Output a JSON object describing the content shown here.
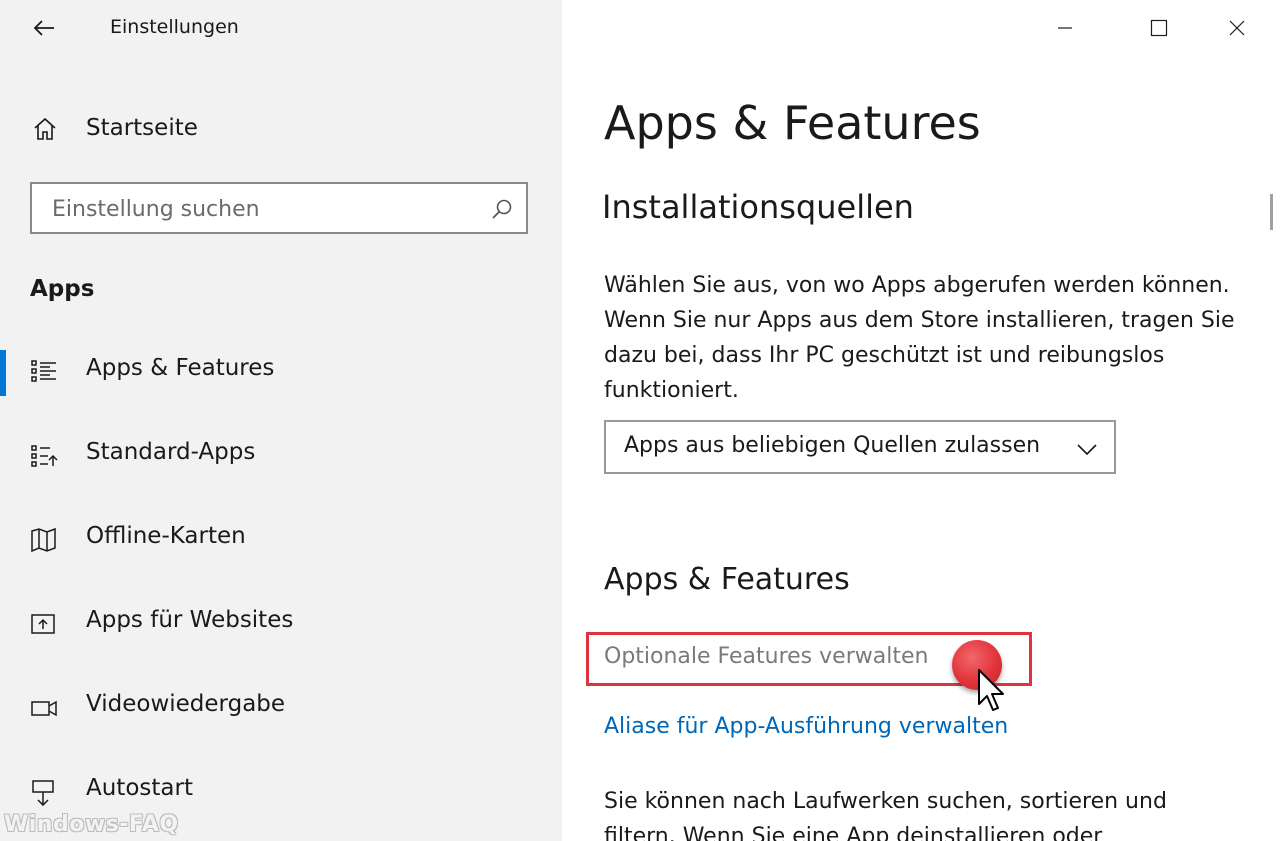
{
  "window": {
    "title": "Einstellungen",
    "controls": {
      "minimize": "minimize-icon",
      "maximize": "maximize-icon",
      "close": "close-icon"
    }
  },
  "sidebar": {
    "home_label": "Startseite",
    "search": {
      "placeholder": "Einstellung suchen",
      "value": ""
    },
    "section_label": "Apps",
    "items": [
      {
        "label": "Apps & Features",
        "icon": "apps-features-icon",
        "selected": true
      },
      {
        "label": "Standard-Apps",
        "icon": "default-apps-icon",
        "selected": false
      },
      {
        "label": "Offline-Karten",
        "icon": "map-icon",
        "selected": false
      },
      {
        "label": "Apps für Websites",
        "icon": "apps-websites-icon",
        "selected": false
      },
      {
        "label": "Videowiedergabe",
        "icon": "video-icon",
        "selected": false
      },
      {
        "label": "Autostart",
        "icon": "autostart-icon",
        "selected": false
      }
    ]
  },
  "main": {
    "title": "Apps & Features",
    "install_sources": {
      "heading": "Installationsquellen",
      "description": "Wählen Sie aus, von wo Apps abgerufen werden können. Wenn Sie nur Apps aus dem Store installieren, tragen Sie dazu bei, dass Ihr PC geschützt ist und reibungslos funktioniert.",
      "dropdown_value": "Apps aus beliebigen Quellen zulassen"
    },
    "apps_features": {
      "heading": "Apps & Features",
      "link_optional": "Optionale Features verwalten",
      "link_alias": "Aliase für App-Ausführung verwalten",
      "description": "Sie können nach Laufwerken suchen, sortieren und filtern. Wenn Sie eine App deinstallieren oder"
    }
  },
  "watermark": "Windows-FAQ",
  "colors": {
    "accent": "#0078d7",
    "link": "#0067b8",
    "highlight": "#e0343c",
    "sidebar_bg": "#f2f2f2"
  }
}
